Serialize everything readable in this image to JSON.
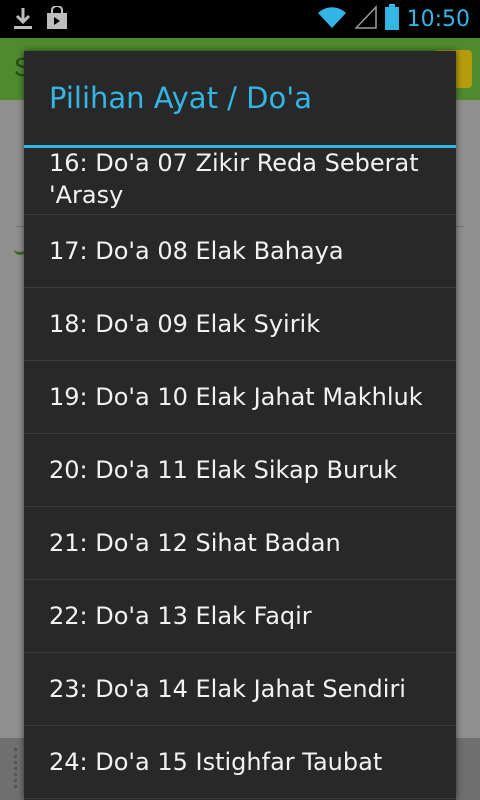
{
  "status_bar": {
    "time": "10:50",
    "icons": [
      "download-icon",
      "shopping-bag-icon",
      "wifi-icon",
      "signal-icon",
      "battery-icon"
    ]
  },
  "background": {
    "header_text": "S"
  },
  "dialog": {
    "title": "Pilihan Ayat / Do'a",
    "items": [
      {
        "label": "16: Do'a 07 Zikir Reda Seberat 'Arasy"
      },
      {
        "label": "17: Do'a 08 Elak Bahaya"
      },
      {
        "label": "18: Do'a 09 Elak Syirik"
      },
      {
        "label": "19: Do'a 10 Elak Jahat Makhluk"
      },
      {
        "label": "20: Do'a 11 Elak Sikap Buruk"
      },
      {
        "label": "21: Do'a 12 Sihat Badan"
      },
      {
        "label": "22: Do'a 13 Elak Faqir"
      },
      {
        "label": "23: Do'a 14 Elak Jahat Sendiri"
      },
      {
        "label": "24: Do'a 15 Istighfar Taubat"
      }
    ]
  },
  "colors": {
    "accent": "#33b5e5",
    "dialog_bg": "#282828",
    "text": "#f2f2f2"
  }
}
